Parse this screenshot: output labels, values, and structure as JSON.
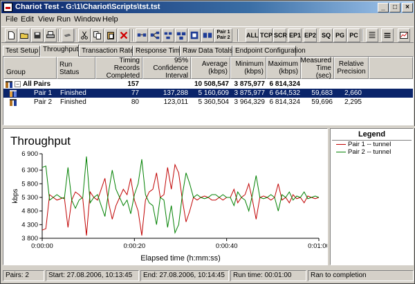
{
  "window": {
    "title": "Chariot Test - G:\\1\\Chariot\\Scripts\\tst.tst"
  },
  "menu": [
    "File",
    "Edit",
    "View",
    "Run",
    "Window",
    "Help"
  ],
  "toolbar": {
    "text_buttons": [
      "ALL",
      "TCP",
      "SCR",
      "EP1",
      "EP2",
      "SQ",
      "PG",
      "PC"
    ],
    "pair_button": [
      "Pair 1",
      "Pair 2"
    ]
  },
  "tabs": [
    "Test Setup",
    "Throughput",
    "Transaction Rate",
    "Response Time",
    "Raw Data Totals",
    "Endpoint Configuration"
  ],
  "active_tab": "Throughput",
  "table": {
    "headers": [
      "Group",
      "Run Status",
      "Timing Records Completed",
      "95% Confidence Interval",
      "Average (kbps)",
      "Minimum (kbps)",
      "Maximum (kbps)",
      "Measured Time (sec)",
      "Relative Precision"
    ],
    "rows": [
      {
        "group": "All Pairs",
        "status": "",
        "records": "157",
        "ci": "",
        "avg": "10 508,547",
        "min": "3 875,977",
        "max": "6 814,324",
        "time": "",
        "precision": ""
      },
      {
        "group": "Pair 1",
        "status": "Finished",
        "records": "77",
        "ci": "137,288",
        "avg": "5 160,609",
        "min": "3 875,977",
        "max": "6 644,532",
        "time": "59,683",
        "precision": "2,660"
      },
      {
        "group": "Pair 2",
        "status": "Finished",
        "records": "80",
        "ci": "123,011",
        "avg": "5 360,504",
        "min": "3 964,329",
        "max": "6 814,324",
        "time": "59,696",
        "precision": "2,295"
      }
    ]
  },
  "chart_data": {
    "type": "line",
    "title": "Throughput",
    "xlabel": "Elapsed time (h:mm:ss)",
    "ylabel": "kbps",
    "ylim": [
      3800,
      6900
    ],
    "xlim": [
      0,
      60
    ],
    "yticks": [
      3800,
      4300,
      4800,
      5300,
      5800,
      6300,
      6900
    ],
    "ytick_labels": [
      "3 800",
      "4 300",
      "4 800",
      "5 300",
      "5 800",
      "6 300",
      "6 900"
    ],
    "xticks": [
      0,
      20,
      40,
      60
    ],
    "xtick_labels": [
      "0:00:00",
      "0:00:20",
      "0:00:40",
      "0:01:00"
    ],
    "grid": false,
    "series": [
      {
        "name": "Pair 1 -- tunnel",
        "color": "#c00000",
        "x": [
          0,
          0.8,
          1.6,
          2.4,
          3.2,
          4.0,
          4.8,
          5.6,
          6.4,
          7.2,
          8.0,
          8.8,
          9.6,
          10.4,
          11.2,
          12.0,
          12.8,
          13.6,
          14.4,
          15.2,
          16.0,
          16.8,
          17.6,
          18.4,
          19.2,
          20.0,
          20.8,
          21.6,
          22.4,
          23.2,
          24.0,
          24.8,
          25.6,
          26.4,
          27.2,
          28.0,
          28.8,
          29.6,
          30.4,
          31.2,
          32.0,
          32.8,
          33.6,
          34.4,
          35.2,
          36.0,
          36.8,
          37.6,
          38.4,
          39.2,
          40.0,
          40.8,
          41.6,
          42.4,
          43.2,
          44.0,
          44.8,
          45.6,
          46.4,
          47.2,
          48.0,
          48.8,
          49.6,
          50.4,
          51.2,
          52.0,
          52.8,
          53.6,
          54.4,
          55.2,
          56.0,
          56.8,
          57.6,
          58.4,
          59.2,
          60.0
        ],
        "values": [
          4100,
          4150,
          5400,
          5300,
          5200,
          5250,
          5300,
          4200,
          5200,
          5500,
          5400,
          5250,
          3900,
          5500,
          5300,
          5200,
          5600,
          6000,
          5100,
          4500,
          5000,
          5300,
          5600,
          5400,
          6000,
          5200,
          4800,
          3900,
          5200,
          5500,
          5600,
          6200,
          5300,
          5400,
          6400,
          5600,
          6500,
          6200,
          5200,
          4400,
          4800,
          5300,
          5200,
          5300,
          5350,
          5300,
          5200,
          5200,
          5300,
          5200,
          5300,
          5300,
          5600,
          5100,
          5300,
          5400,
          5800,
          5200,
          4500,
          5300,
          5350,
          5300,
          5200,
          5300,
          5800,
          5200,
          5300,
          5100,
          5400,
          5250,
          5300,
          5100,
          5350,
          5300,
          5250,
          5300
        ]
      },
      {
        "name": "Pair 2 -- tunnel",
        "color": "#008000",
        "x": [
          0,
          0.8,
          1.6,
          2.4,
          3.2,
          4.0,
          4.8,
          5.6,
          6.4,
          7.2,
          8.0,
          8.8,
          9.6,
          10.4,
          11.2,
          12.0,
          12.8,
          13.6,
          14.4,
          15.2,
          16.0,
          16.8,
          17.6,
          18.4,
          19.2,
          20.0,
          20.8,
          21.6,
          22.4,
          23.2,
          24.0,
          24.8,
          25.6,
          26.4,
          27.2,
          28.0,
          28.8,
          29.6,
          30.4,
          31.2,
          32.0,
          32.8,
          33.6,
          34.4,
          35.2,
          36.0,
          36.8,
          37.6,
          38.4,
          39.2,
          40.0,
          40.8,
          41.6,
          42.4,
          43.2,
          44.0,
          44.8,
          45.6,
          46.4,
          47.2,
          48.0,
          48.8,
          49.6,
          50.4,
          51.2,
          52.0,
          52.8,
          53.6,
          54.4,
          55.2,
          56.0,
          56.8,
          57.6,
          58.4,
          59.2,
          60.0
        ],
        "values": [
          6400,
          6450,
          5200,
          5300,
          5400,
          5300,
          5250,
          6400,
          5200,
          4900,
          5200,
          5300,
          6800,
          5100,
          5300,
          5400,
          5000,
          4600,
          5500,
          6300,
          5600,
          5300,
          5000,
          5200,
          4700,
          5400,
          5800,
          6700,
          5400,
          5100,
          5000,
          4300,
          5300,
          5200,
          4200,
          5000,
          4000,
          4300,
          5400,
          6200,
          5800,
          5300,
          5400,
          5300,
          5250,
          5300,
          5400,
          5400,
          5300,
          5400,
          5300,
          5300,
          5000,
          5500,
          5300,
          5200,
          4800,
          5400,
          6100,
          5300,
          5250,
          5300,
          5400,
          5300,
          4800,
          5400,
          5300,
          5500,
          5200,
          5350,
          5300,
          5500,
          5250,
          5300,
          5350,
          5300
        ]
      }
    ]
  },
  "legend": {
    "title": "Legend"
  },
  "status": {
    "pairs": "Pairs: 2",
    "start": "Start: 27.08.2006, 10:13:45",
    "end": "End: 27.08.2006, 10:14:45",
    "run_time": "Run time: 00:01:00",
    "completion": "Ran to completion"
  }
}
